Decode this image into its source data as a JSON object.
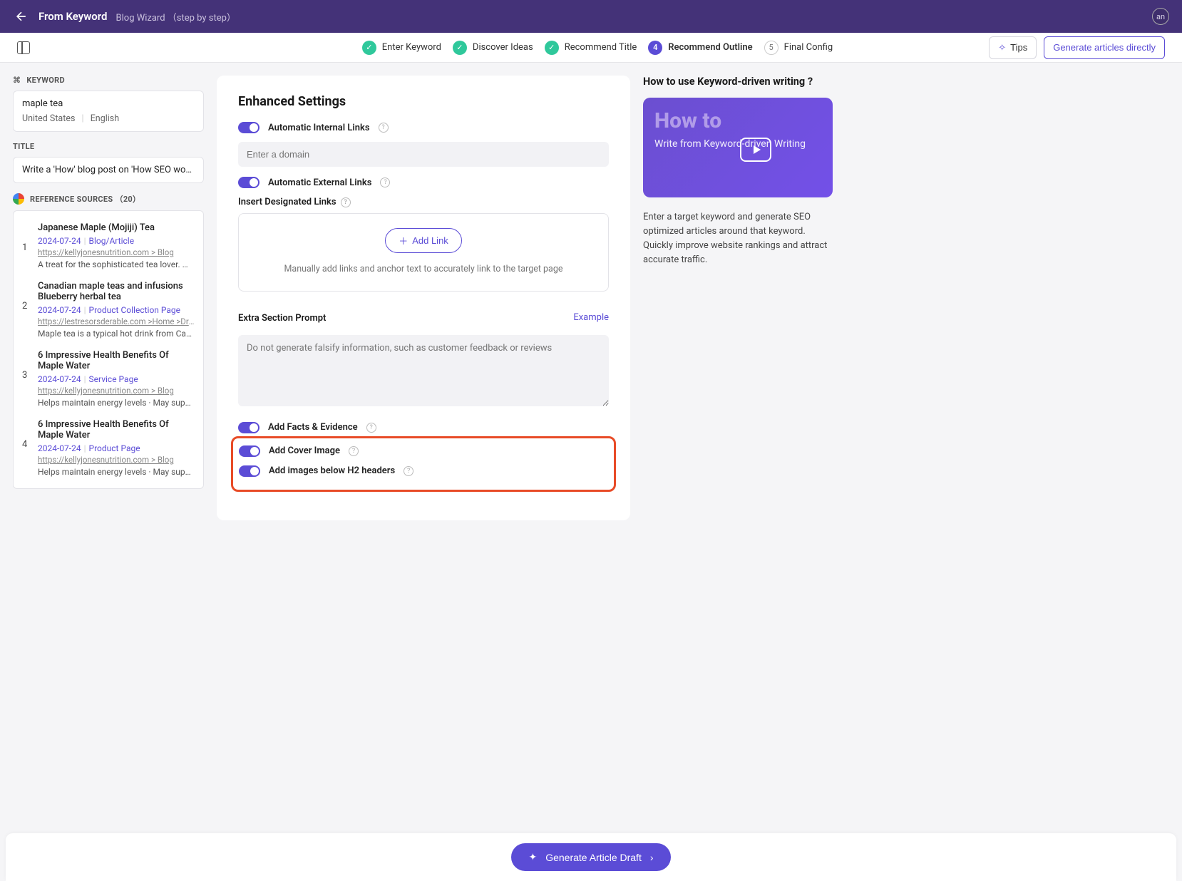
{
  "header": {
    "title": "From Keyword",
    "subtitle": "Blog Wizard （step by step）",
    "avatar": "an"
  },
  "steps": [
    {
      "label": "Enter Keyword",
      "state": "done"
    },
    {
      "label": "Discover Ideas",
      "state": "done"
    },
    {
      "label": "Recommend Title",
      "state": "done"
    },
    {
      "label": "Recommend Outline",
      "state": "active",
      "num": "4"
    },
    {
      "label": "Final Config",
      "state": "pending",
      "num": "5"
    }
  ],
  "toolbar": {
    "tips": "Tips",
    "generate_direct": "Generate articles directly"
  },
  "left": {
    "keyword_label": "KEYWORD",
    "keyword": "maple tea",
    "country": "United States",
    "language": "English",
    "title_label": "TITLE",
    "title_value": "Write a 'How' blog post on 'How SEO works",
    "ref_label": "REFERENCE SOURCES （20）",
    "refs": [
      {
        "num": "1",
        "title": "Japanese Maple (Mojiji) Tea",
        "date": "2024-07-24",
        "type": "Blog/Article",
        "url": "https://kellyjonesnutrition.com > Blog",
        "desc": "A treat for the sophisticated tea lover. Ma…"
      },
      {
        "num": "2",
        "title": "Canadian maple teas and infusions Blueberry herbal tea",
        "date": "2024-07-24",
        "type": "Product Collection Page",
        "url": "https://lestresorsderable.com >Home >Drinks",
        "desc": "Maple tea is a typical hot drink from Cana…"
      },
      {
        "num": "3",
        "title": "6 Impressive Health Benefits Of Maple Water",
        "date": "2024-07-24",
        "type": "Service Page",
        "url": "https://kellyjonesnutrition.com > Blog",
        "desc": "Helps maintain energy levels · May suppo…"
      },
      {
        "num": "4",
        "title": "6 Impressive Health Benefits Of Maple Water",
        "date": "2024-07-24",
        "type": "Product Page",
        "url": "https://kellyjonesnutrition.com > Blog",
        "desc": "Helps maintain energy levels · May suppo…"
      }
    ]
  },
  "center": {
    "heading": "Enhanced Settings",
    "auto_internal": "Automatic Internal Links",
    "domain_placeholder": "Enter a domain",
    "auto_external": "Automatic External Links",
    "insert_links": "Insert Designated Links",
    "add_link": "Add Link",
    "link_hint": "Manually add links and anchor text to accurately link to the target page",
    "extra_prompt": "Extra Section Prompt",
    "example": "Example",
    "textarea_placeholder": "Do not generate falsify information, such as customer feedback or reviews",
    "add_facts": "Add Facts & Evidence",
    "add_cover": "Add Cover Image",
    "add_h2_images": "Add images below H2 headers"
  },
  "right": {
    "heading": "How to use Keyword-driven writing ?",
    "card_big": "How to",
    "card_sub": "Write from Keyword-driven Writing",
    "desc": "Enter a target keyword and generate SEO optimized articles around that keyword. Quickly improve website rankings and attract accurate traffic."
  },
  "footer": {
    "button": "Generate Article Draft"
  }
}
